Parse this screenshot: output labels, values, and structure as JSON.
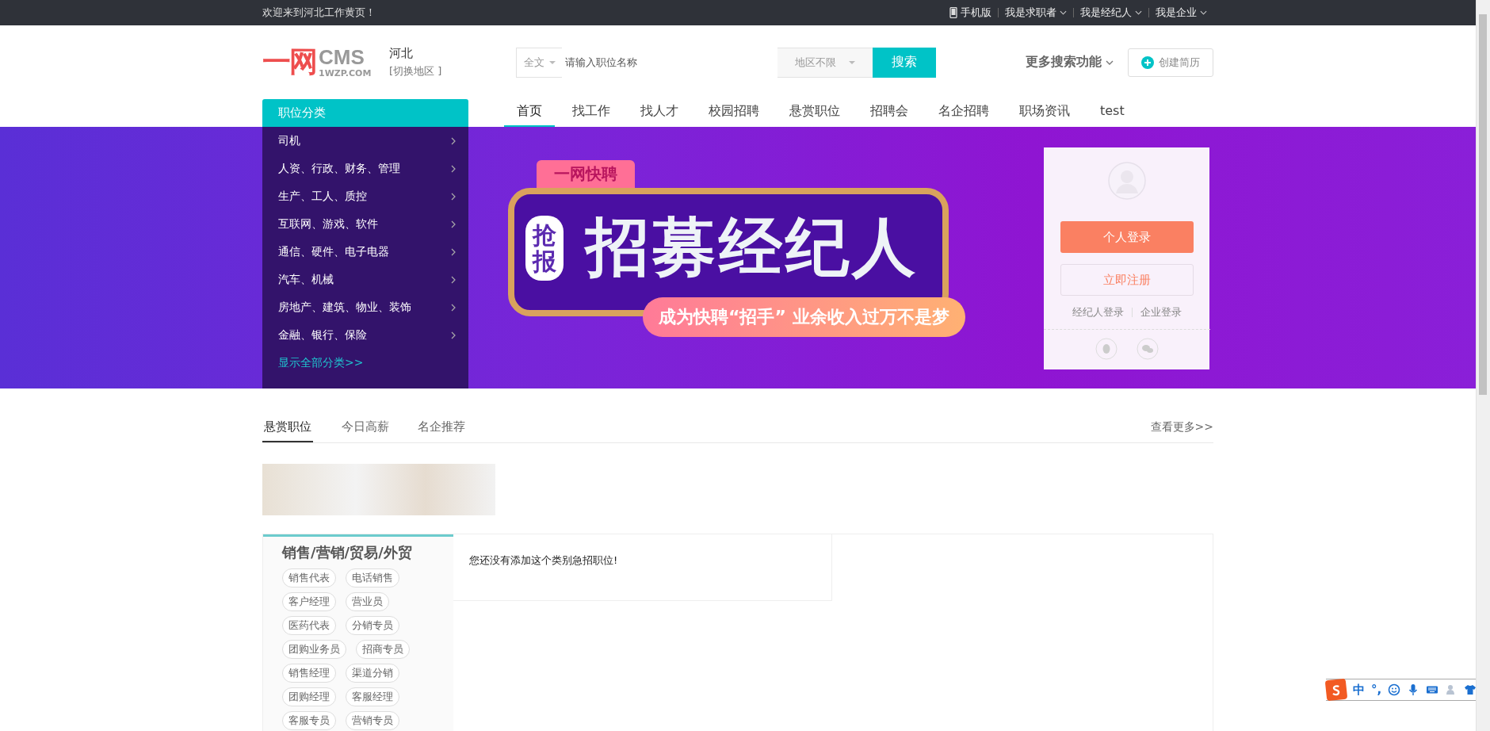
{
  "top_bar": {
    "welcome": "欢迎来到河北工作黄页！",
    "links": [
      {
        "label": "手机版",
        "kind": "mobile"
      },
      {
        "label": "我是求职者",
        "kind": "dropdown"
      },
      {
        "label": "我是经纪人",
        "kind": "dropdown"
      },
      {
        "label": "我是企业",
        "kind": "dropdown"
      }
    ]
  },
  "logo": {
    "mark": "一网",
    "name": "CMS",
    "domain": "1WZP.COM"
  },
  "region": {
    "name": "河北",
    "switch": "[切换地区 ]"
  },
  "search": {
    "scope": "全文",
    "placeholder": "请输入职位名称",
    "area": "地区不限",
    "button": "搜索"
  },
  "more_search": "更多搜索功能",
  "create_resume": "创建简历",
  "category_menu": {
    "title": "职位分类",
    "items": [
      "司机",
      "人资、行政、财务、管理",
      "生产、工人、质控",
      "互联网、游戏、软件",
      "通信、硬件、电子电器",
      "汽车、机械",
      "房地产、建筑、物业、装饰",
      "金融、银行、保险"
    ],
    "show_all": "显示全部分类>>"
  },
  "nav": [
    {
      "label": "首页",
      "selected": true
    },
    {
      "label": "找工作",
      "selected": false
    },
    {
      "label": "找人才",
      "selected": false
    },
    {
      "label": "校园招聘",
      "selected": false
    },
    {
      "label": "悬赏职位",
      "selected": false
    },
    {
      "label": "招聘会",
      "selected": false
    },
    {
      "label": "名企招聘",
      "selected": false
    },
    {
      "label": "职场资讯",
      "selected": false
    },
    {
      "label": "test",
      "selected": false
    }
  ],
  "banner": {
    "tag": "一网快聘",
    "badge": "抢报",
    "headline": "招募经纪人",
    "slogan": "成为快聘“招手” 业余收入过万不是梦"
  },
  "login_box": {
    "personal_login": "个人登录",
    "register": "立即注册",
    "links": [
      "经纪人登录",
      "企业登录"
    ]
  },
  "section_tabs": [
    {
      "label": "悬赏职位",
      "selected": true
    },
    {
      "label": "今日高薪",
      "selected": false
    },
    {
      "label": "名企推荐",
      "selected": false
    }
  ],
  "more_link": "查看更多>>",
  "category_panel": {
    "title": "销售/营销/贸易/外贸",
    "tags": [
      "销售代表",
      "电话销售",
      "客户经理",
      "营业员",
      "医药代表",
      "分销专员",
      "团购业务员",
      "招商专员",
      "销售经理",
      "渠道分销",
      "团购经理",
      "客服经理",
      "客服专员",
      "营销专员"
    ]
  },
  "empty_message": "您还没有添加这个类别急招职位!",
  "ime_bar": {
    "mode": "中",
    "punctuation": "°,"
  }
}
